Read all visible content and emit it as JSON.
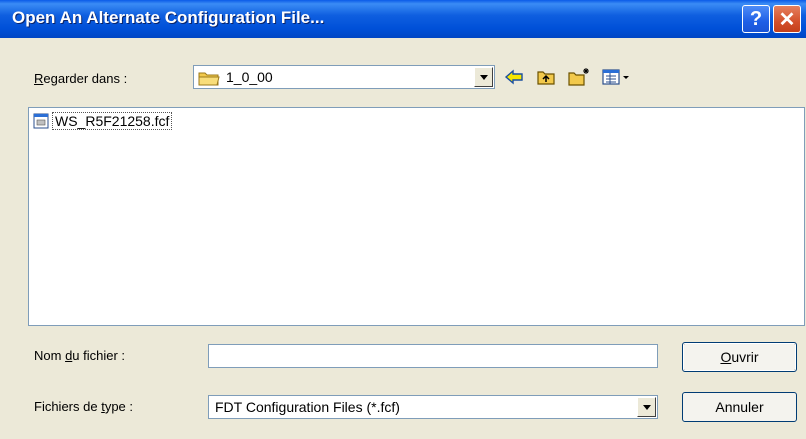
{
  "window": {
    "title": "Open An Alternate Configuration File...",
    "help_glyph": "?",
    "close_glyph": "✕"
  },
  "lookin": {
    "label_prefix": "",
    "label_accel": "R",
    "label_rest": "egarder dans :",
    "value": "1_0_00",
    "folder_icon": "folder-icon"
  },
  "toolbar": {
    "icons": [
      "back-arrow-icon",
      "up-folder-icon",
      "new-folder-icon",
      "view-menu-icon"
    ],
    "colors": {
      "back": "#f7e600",
      "folder": "#f2c94c"
    }
  },
  "files": [
    {
      "name": "WS_R5F21258.fcf",
      "icon": "fcf-file-icon"
    }
  ],
  "filename": {
    "label_prefix": "Nom ",
    "label_accel": "d",
    "label_rest": "u fichier :",
    "value": "",
    "placeholder": ""
  },
  "filetype": {
    "label_prefix": "Fichiers de ",
    "label_accel": "t",
    "label_rest": "ype :",
    "value": "FDT Configuration Files (*.fcf)"
  },
  "buttons": {
    "open_accel": "O",
    "open_rest": "uvrir",
    "cancel": "Annuler"
  },
  "colors": {
    "titlebar": "#0054e3",
    "dialog_bg": "#ece9d8",
    "field_border": "#7f9db9",
    "close_btn": "#d4502b"
  }
}
